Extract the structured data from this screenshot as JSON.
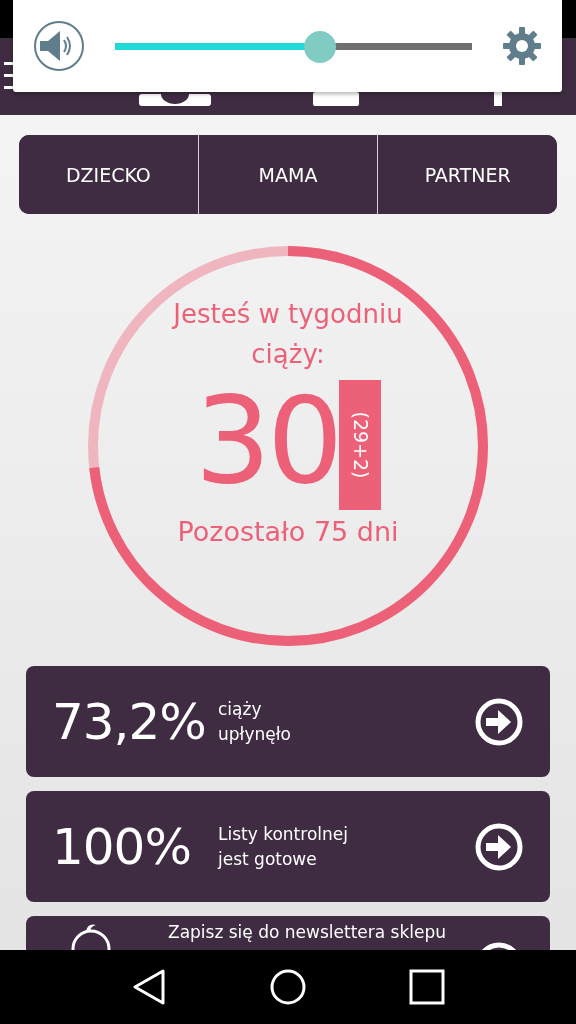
{
  "volume_popup": {
    "level": 0.574
  },
  "tabs": [
    {
      "label": "DZIECKO"
    },
    {
      "label": "MAMA"
    },
    {
      "label": "PARTNER"
    }
  ],
  "progress_ring": {
    "level": 0.732,
    "heading": "Jesteś w tygodniu ciąży:",
    "week": "30",
    "week_detail": "(29+2)",
    "remaining": "Pozostało 75 dni"
  },
  "cards": [
    {
      "value": "73,2%",
      "label": "ciąży\nupłynęło"
    },
    {
      "value": "100%",
      "label": "Listy kontrolnej\njest gotowe"
    },
    {
      "label": "Zapisz się do newslettera sklepu",
      "kind": "newsletter"
    }
  ]
}
